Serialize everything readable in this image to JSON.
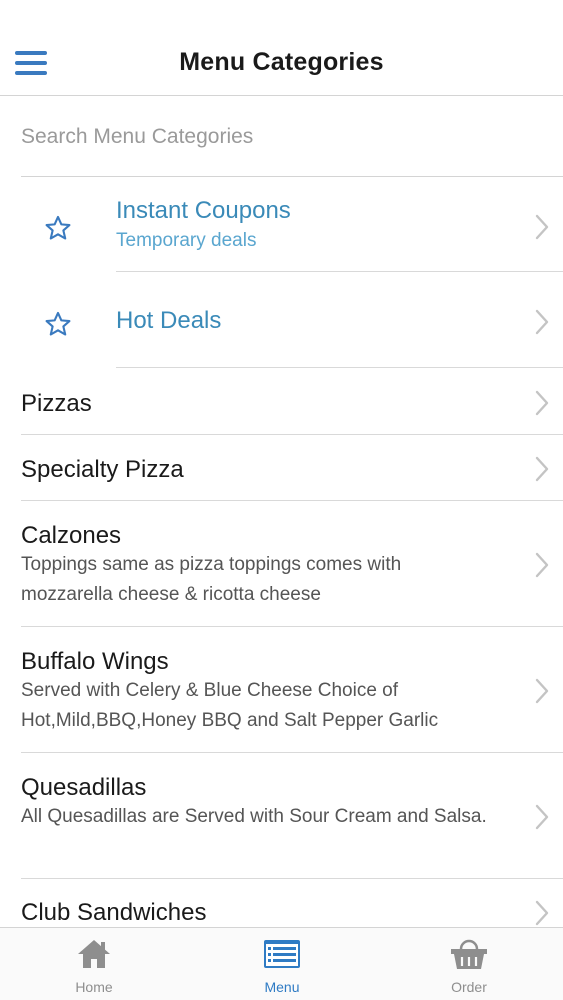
{
  "header": {
    "title": "Menu Categories",
    "menu_icon": "hamburger-icon"
  },
  "search": {
    "placeholder": "Search Menu Categories",
    "value": ""
  },
  "featured": [
    {
      "title": "Instant Coupons",
      "subtitle": "Temporary deals",
      "icon": "star-icon"
    },
    {
      "title": "Hot Deals",
      "subtitle": "",
      "icon": "star-icon"
    }
  ],
  "categories": [
    {
      "title": "Pizzas",
      "description": ""
    },
    {
      "title": "Specialty Pizza",
      "description": ""
    },
    {
      "title": "Calzones",
      "description": "Toppings same as pizza toppings comes with mozzarella cheese & ricotta cheese"
    },
    {
      "title": "Buffalo Wings",
      "description": "Served with Celery & Blue Cheese Choice of Hot,Mild,BBQ,Honey BBQ and Salt Pepper Garlic"
    },
    {
      "title": "Quesadillas",
      "description": "All Quesadillas are Served with Sour Cream and Salsa."
    },
    {
      "title": "Club Sandwiches",
      "description": ""
    }
  ],
  "tabbar": {
    "items": [
      {
        "label": "Home",
        "icon": "home-icon",
        "active": false
      },
      {
        "label": "Menu",
        "icon": "menu-list-icon",
        "active": true
      },
      {
        "label": "Order",
        "icon": "basket-icon",
        "active": false
      }
    ]
  },
  "colors": {
    "accent": "#3a7abf",
    "featured_text": "#3a8ab8",
    "featured_sub": "#5aa6cf",
    "separator": "#d9d9d9",
    "chevron": "#c4c4c4"
  }
}
